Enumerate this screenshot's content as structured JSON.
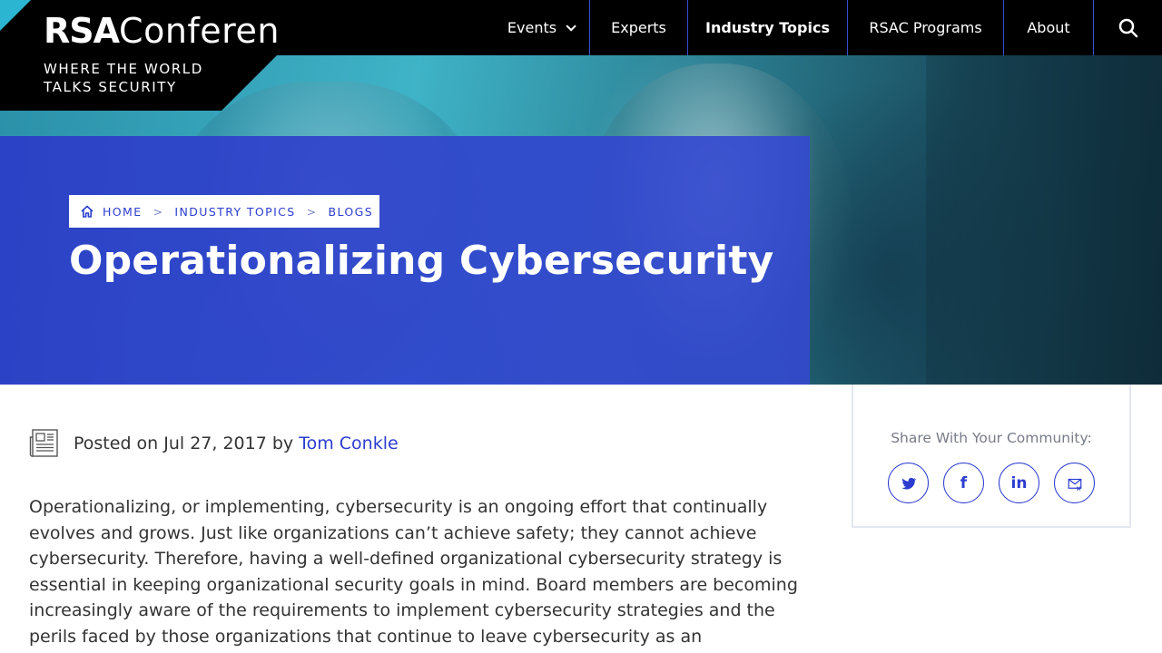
{
  "brand": {
    "logo_rsa": "RSA",
    "logo_conference": "Conference",
    "tagline_line1": "WHERE THE WORLD",
    "tagline_line2": "TALKS SECURITY"
  },
  "nav": {
    "events": "Events",
    "experts": "Experts",
    "industry_topics": "Industry Topics",
    "programs": "RSAC Programs",
    "about": "About"
  },
  "breadcrumb": {
    "home": "HOME",
    "topics": "INDUSTRY TOPICS",
    "blogs": "BLOGS",
    "separator": ">"
  },
  "article": {
    "title": "Operationalizing Cybersecurity",
    "posted_prefix": "Posted on Jul 27, 2017 by",
    "author": "Tom Conkle",
    "body": "Operationalizing, or implementing, cybersecurity is an ongoing effort that continually evolves and grows.  Just like organizations can’t achieve safety; they cannot achieve cybersecurity.  Therefore, having a well-defined organizational cybersecurity strategy is essential in keeping organizational security goals in mind. Board members are becoming increasingly aware of the requirements to implement cybersecurity strategies and the perils faced by those organizations that continue to leave cybersecurity as an"
  },
  "share": {
    "label": "Share With Your Community:",
    "linkedin_text": "in",
    "facebook_text": "f",
    "icons": [
      "twitter-icon",
      "facebook-icon",
      "linkedin-icon",
      "email-icon"
    ]
  },
  "colors": {
    "accent_blue": "#2b3ccf",
    "overlay_blue": "#2c3cc8",
    "nav_bg": "#000000",
    "logo_accent": "#2bb5d0"
  }
}
